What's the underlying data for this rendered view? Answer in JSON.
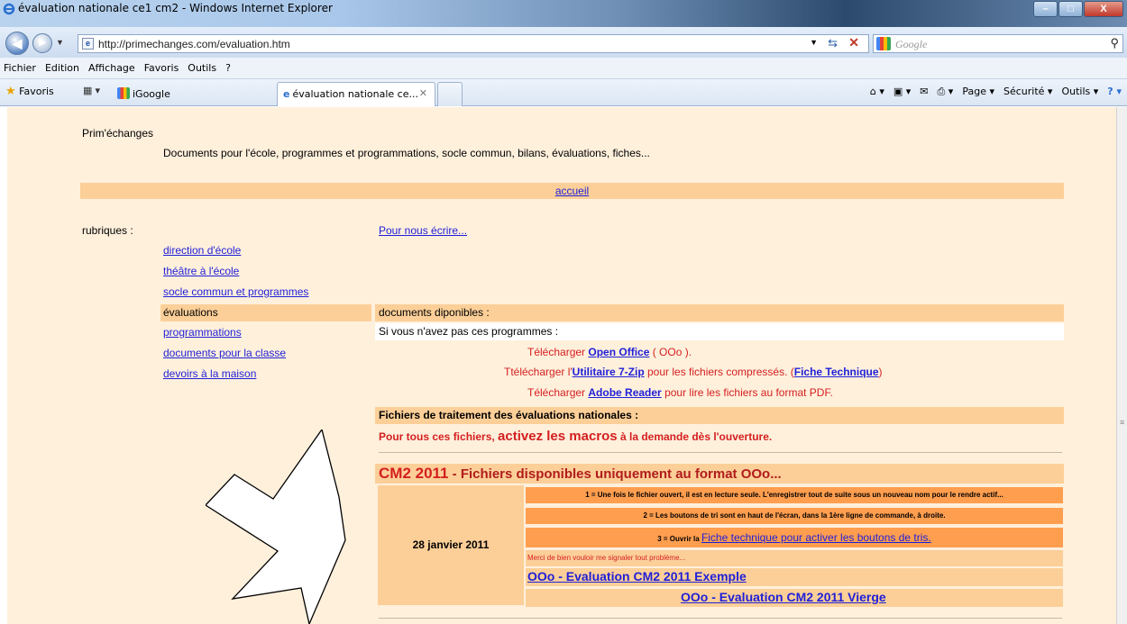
{
  "window": {
    "title": "évaluation nationale ce1 cm2 - Windows Internet Explorer",
    "minimize": "–",
    "maximize": "□",
    "close": "X"
  },
  "address": {
    "url": "http://primechanges.com/evaluation.htm",
    "search_placeholder": "Google"
  },
  "menu": [
    "Fichier",
    "Edition",
    "Affichage",
    "Favoris",
    "Outils",
    "?"
  ],
  "favorites": {
    "label": "Favoris",
    "tab_igoogle": "iGoogle",
    "tab_active": "évaluation nationale ce...",
    "cmd_page": "Page ▾",
    "cmd_securite": "Sécurité ▾",
    "cmd_outils": "Outils ▾"
  },
  "site": {
    "name": "Prim'échanges",
    "description": "Documents pour l'école, programmes et programmations, socle commun, bilans, évaluations, fiches...",
    "accueil": "accueil",
    "rubriques_label": "rubriques :",
    "ecrire": "Pour nous écrire..."
  },
  "sidebar": [
    {
      "label": "direction d'école"
    },
    {
      "label": "théâtre à l'école"
    },
    {
      "label": "socle commun et programmes"
    },
    {
      "label": "évaluations"
    },
    {
      "label": "programmations"
    },
    {
      "label": "documents pour la classe"
    },
    {
      "label": "devoirs à la maison"
    }
  ],
  "docs": {
    "header": "documents diponibles :",
    "intro": "Si vous n'avez pas ces programmes :",
    "dl1_pre": "Télécharger ",
    "dl1_link": "Open Office",
    "dl1_post": " ( OOo ).",
    "dl2_pre": "Ttélécharger l'",
    "dl2_link": "Utilitaire 7-Zip",
    "dl2_mid": " pour les fichiers compressés. (",
    "dl2_link2": "Fiche Technique",
    "dl2_post": ")",
    "dl3_pre": "Télécharger ",
    "dl3_link": "Adobe Reader",
    "dl3_post": " pour lire les fichiers au format PDF.",
    "fich_header": "Fichiers de traitement des évaluations nationales :",
    "macros_pre": "Pour tous ces fichiers, ",
    "macros_big": "activez les macros",
    "macros_post": " à la demande dès l'ouverture."
  },
  "cm2": {
    "title_big": "CM2 2011",
    "title_rest": " - Fichiers disponibles uniquement au format OOo...",
    "date": "28 janvier 2011",
    "info1": "1 = Une fois le fichier ouvert, il est en lecture seule. L'enregistrer tout de suite sous un nouveau nom pour le rendre actif...",
    "info2": "2 = Les boutons de tri sont en haut de l'écran, dans la 1ère ligne de commande, à droite.",
    "info3_pre": "3 = Ouvrir la ",
    "info3_link": "Fiche technique pour activer les boutons de tris.",
    "info4": "Merci de bien vouloir me signaler tout problème...",
    "link_exemple": "OOo - Evaluation CM2 2011 Exemple",
    "link_vierge": "OOo - Evaluation CM2 2011 Vierge"
  },
  "colors": {
    "page_bg": "#fff0dc",
    "band": "#fccf98",
    "orange_row": "#ff9e4f",
    "link": "#1f1fd8",
    "red_text": "#d41f1f"
  }
}
